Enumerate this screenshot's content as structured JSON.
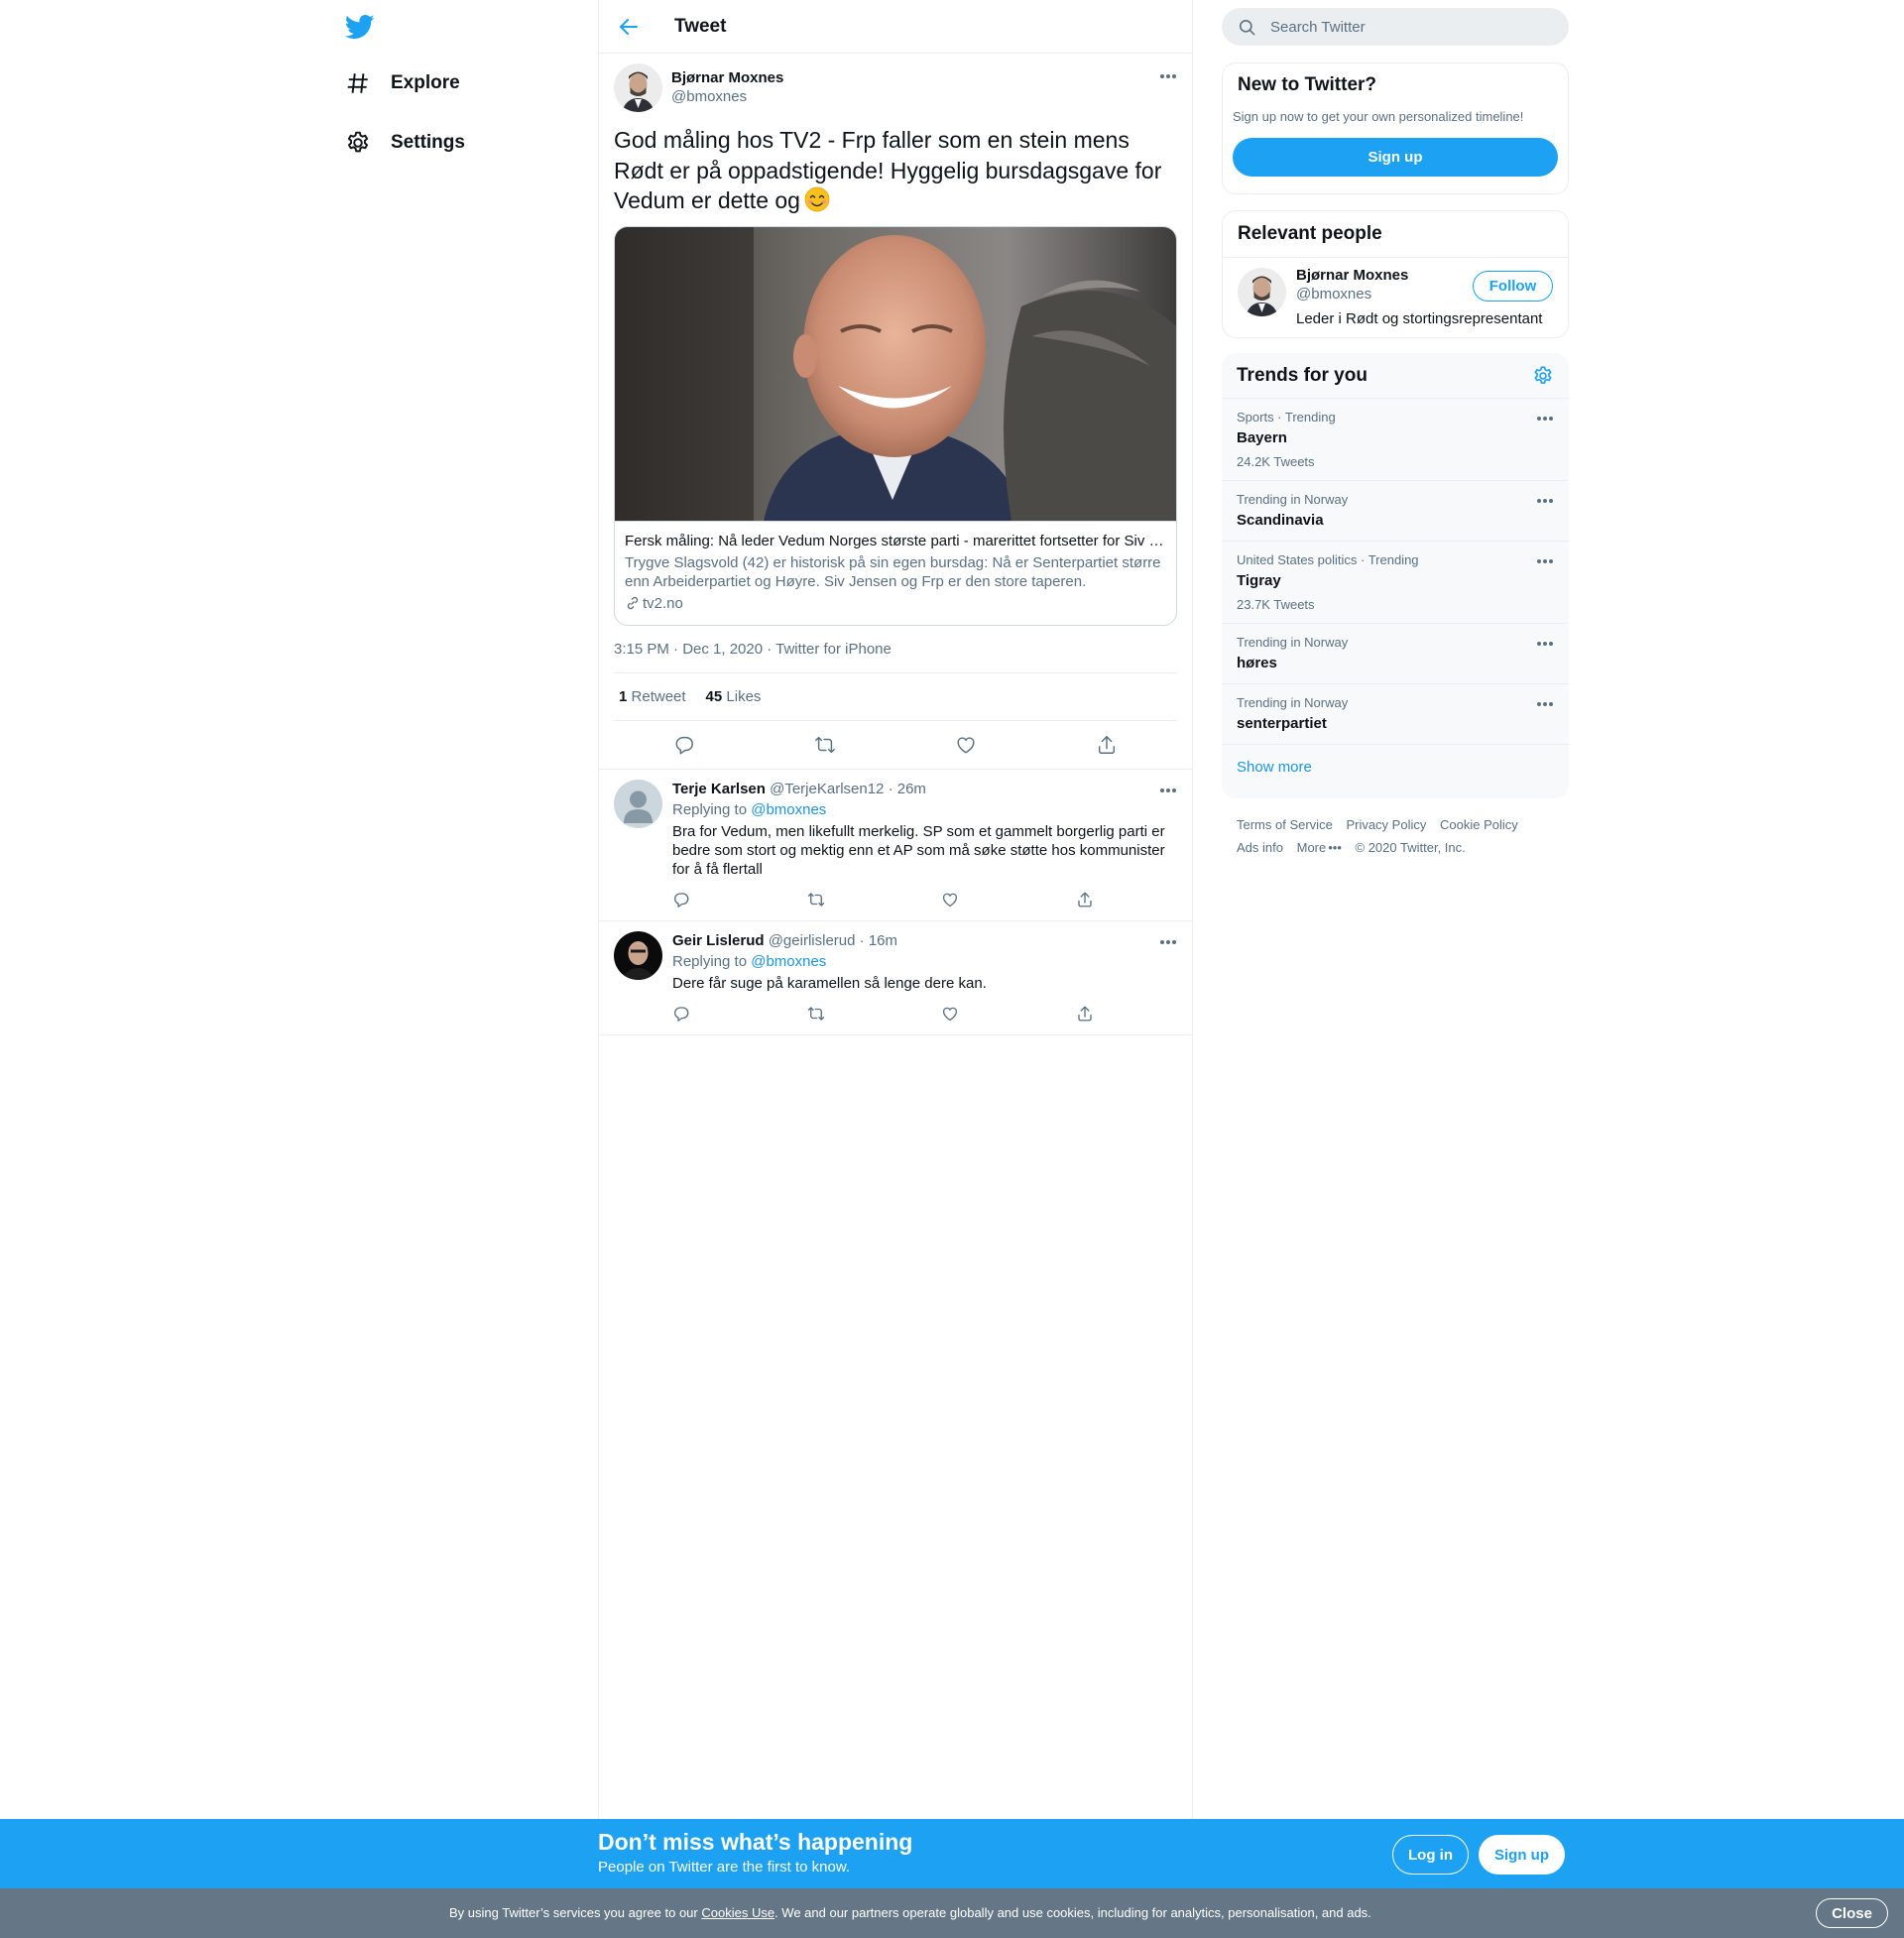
{
  "nav": {
    "items": [
      {
        "label": "Explore",
        "icon": "hashtag-icon"
      },
      {
        "label": "Settings",
        "icon": "gear-icon"
      }
    ]
  },
  "header": {
    "title": "Tweet"
  },
  "tweet": {
    "author_name": "Bjørnar Moxnes",
    "author_handle": "@bmoxnes",
    "text": "God måling hos TV2 - Frp faller som en stein mens Rødt er på oppadstigende! Hyggelig bursdagsgave for Vedum er dette og",
    "emoji": "smiling-face-emoji",
    "card": {
      "title": "Fersk måling: Nå leder Vedum Norges største parti - marerittet fortsetter for Siv …",
      "description": "Trygve Slagsvold (42) er historisk på sin egen bursdag: Nå er Senterpartiet større enn Arbeiderpartiet og Høyre. Siv Jensen og Frp er den store taperen.",
      "domain": "tv2.no"
    },
    "meta": "3:15 PM · Dec 1, 2020 · Twitter for iPhone",
    "retweets_count": "1",
    "retweets_label": "Retweet",
    "likes_count": "45",
    "likes_label": "Likes"
  },
  "replies": [
    {
      "name": "Terje Karlsen",
      "handle": "@TerjeKarlsen12",
      "time": "26m",
      "replying_prefix": "Replying to",
      "replying_to": "@bmoxnes",
      "text": "Bra for Vedum, men likefullt merkelig. SP som et gammelt borgerlig parti er bedre som stort og mektig enn et AP som må søke støtte hos kommunister for å få flertall"
    },
    {
      "name": "Geir Lislerud",
      "handle": "@geirlislerud",
      "time": "16m",
      "replying_prefix": "Replying to",
      "replying_to": "@bmoxnes",
      "text": "Dere får suge på karamellen så lenge dere kan."
    }
  ],
  "search": {
    "placeholder": "Search Twitter"
  },
  "new_to_twitter": {
    "title": "New to Twitter?",
    "subtitle": "Sign up now to get your own personalized timeline!",
    "button": "Sign up"
  },
  "relevant_people": {
    "title": "Relevant people",
    "name": "Bjørnar Moxnes",
    "handle": "@bmoxnes",
    "bio": "Leder i Rødt og stortingsrepresentant",
    "follow": "Follow"
  },
  "trends": {
    "title": "Trends for you",
    "items": [
      {
        "context": "Sports · Trending",
        "name": "Bayern",
        "count": "24.2K Tweets"
      },
      {
        "context": "Trending in Norway",
        "name": "Scandinavia",
        "count": ""
      },
      {
        "context": "United States politics · Trending",
        "name": "Tigray",
        "count": "23.7K Tweets"
      },
      {
        "context": "Trending in Norway",
        "name": "høres",
        "count": ""
      },
      {
        "context": "Trending in Norway",
        "name": "senterpartiet",
        "count": ""
      }
    ],
    "show_more": "Show more"
  },
  "footer": {
    "links": [
      "Terms of Service",
      "Privacy Policy",
      "Cookie Policy",
      "Ads info",
      "More"
    ],
    "copyright": "© 2020 Twitter, Inc."
  },
  "promo": {
    "title": "Don’t miss what’s happening",
    "subtitle": "People on Twitter are the first to know.",
    "login": "Log in",
    "signup": "Sign up"
  },
  "cookie": {
    "before": "By using Twitter’s services you agree to our ",
    "link": "Cookies Use",
    "after": ". We and our partners operate globally and use cookies, including for analytics, personalisation, and ads.",
    "close": "Close"
  },
  "colors": {
    "accent": "#1da1f2",
    "link": "#1b95e0",
    "secondary_text": "#5b7083",
    "cookie_bar": "#657786"
  }
}
